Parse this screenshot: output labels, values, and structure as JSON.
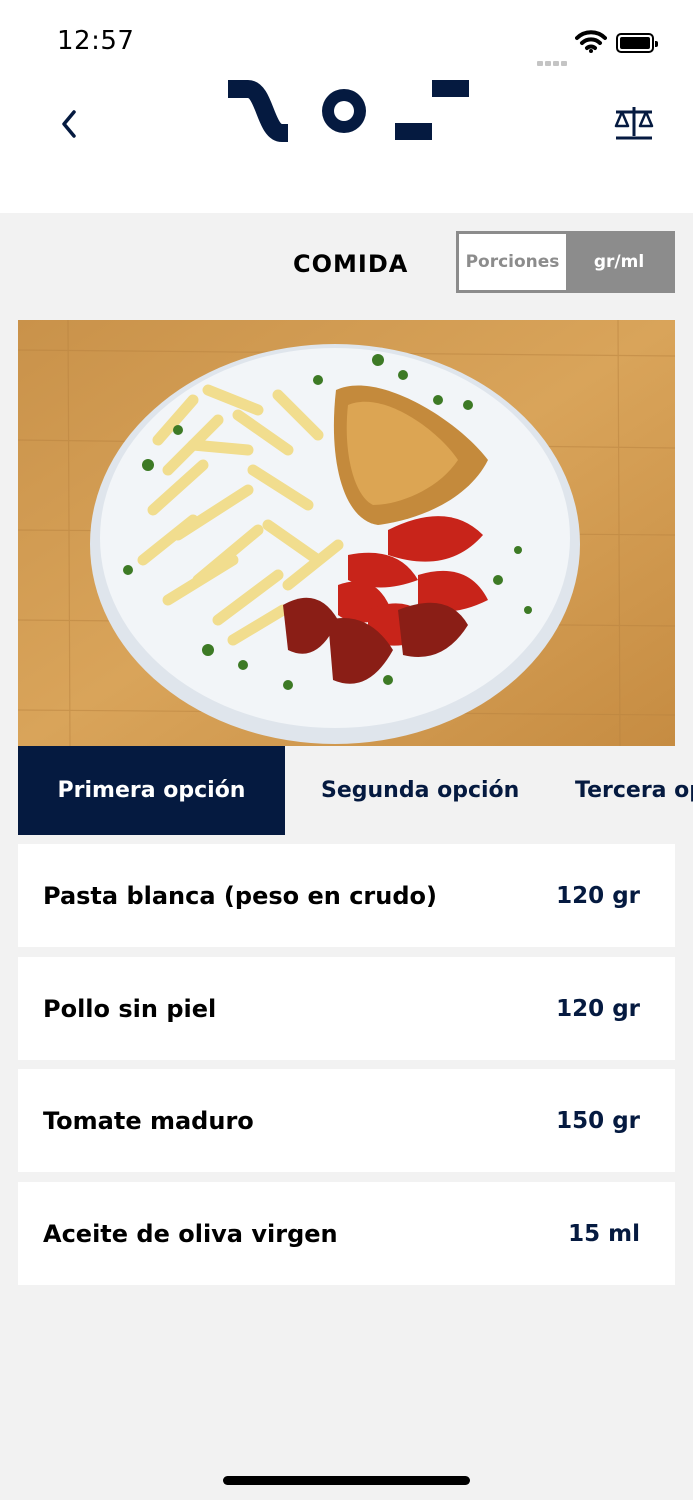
{
  "status_bar": {
    "time": "12:57"
  },
  "header": {
    "back_icon": "chevron-left-icon",
    "logo_icon": "brand-logo",
    "scale_icon": "scale-icon"
  },
  "meal": {
    "title": "COMIDA"
  },
  "unit_toggle": {
    "options": [
      "Porciones",
      "gr/ml"
    ],
    "selected": "gr/ml"
  },
  "photo": {
    "icon": "meal-photo"
  },
  "tabs": [
    {
      "label": "Primera opción",
      "active": true
    },
    {
      "label": "Segunda opción",
      "active": false
    },
    {
      "label": "Tercera opción",
      "active": false
    }
  ],
  "ingredients": [
    {
      "name": "Pasta blanca (peso en crudo)",
      "qty": "120 gr"
    },
    {
      "name": "Pollo sin piel",
      "qty": "120 gr"
    },
    {
      "name": "Tomate maduro",
      "qty": "150 gr"
    },
    {
      "name": "Aceite de oliva virgen",
      "qty": "15 ml"
    }
  ],
  "colors": {
    "navy": "#051a40",
    "toggle_gray": "#8c8c8c",
    "background": "#f2f2f2"
  }
}
